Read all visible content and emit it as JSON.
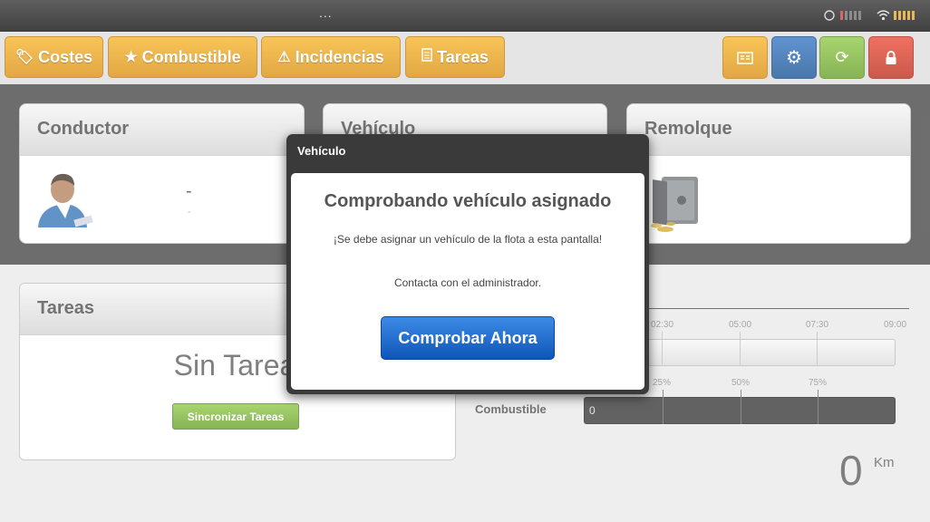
{
  "status_bar": {
    "dots": "..."
  },
  "nav": {
    "costes": "Costes",
    "combustible": "Combustible",
    "incidencias": "Incidencias",
    "tareas": "Tareas"
  },
  "cards": {
    "conductor": {
      "title": "Conductor",
      "name": "-",
      "sub": "-"
    },
    "vehiculo": {
      "title": "Vehículo"
    },
    "remolque": {
      "title": "Remolque"
    }
  },
  "tasks": {
    "title": "Tareas",
    "empty_text": "Sin Tareas o Fin",
    "sync_label": "Sincronizar Tareas"
  },
  "timeline": {
    "ticks": [
      "02:30",
      "05:00",
      "07:30",
      "09:00"
    ]
  },
  "fuel": {
    "label": "Combustible",
    "ticks": [
      "25%",
      "50%",
      "75%"
    ],
    "value_text": "0"
  },
  "odometer": {
    "value": "0",
    "unit": "Km"
  },
  "modal": {
    "header": "Vehículo",
    "heading": "Comprobando vehículo asignado",
    "message": "¡Se debe asignar un vehículo de la flota a esta pantalla!",
    "contact": "Contacta con el administrador.",
    "button": "Comprobar Ahora"
  }
}
